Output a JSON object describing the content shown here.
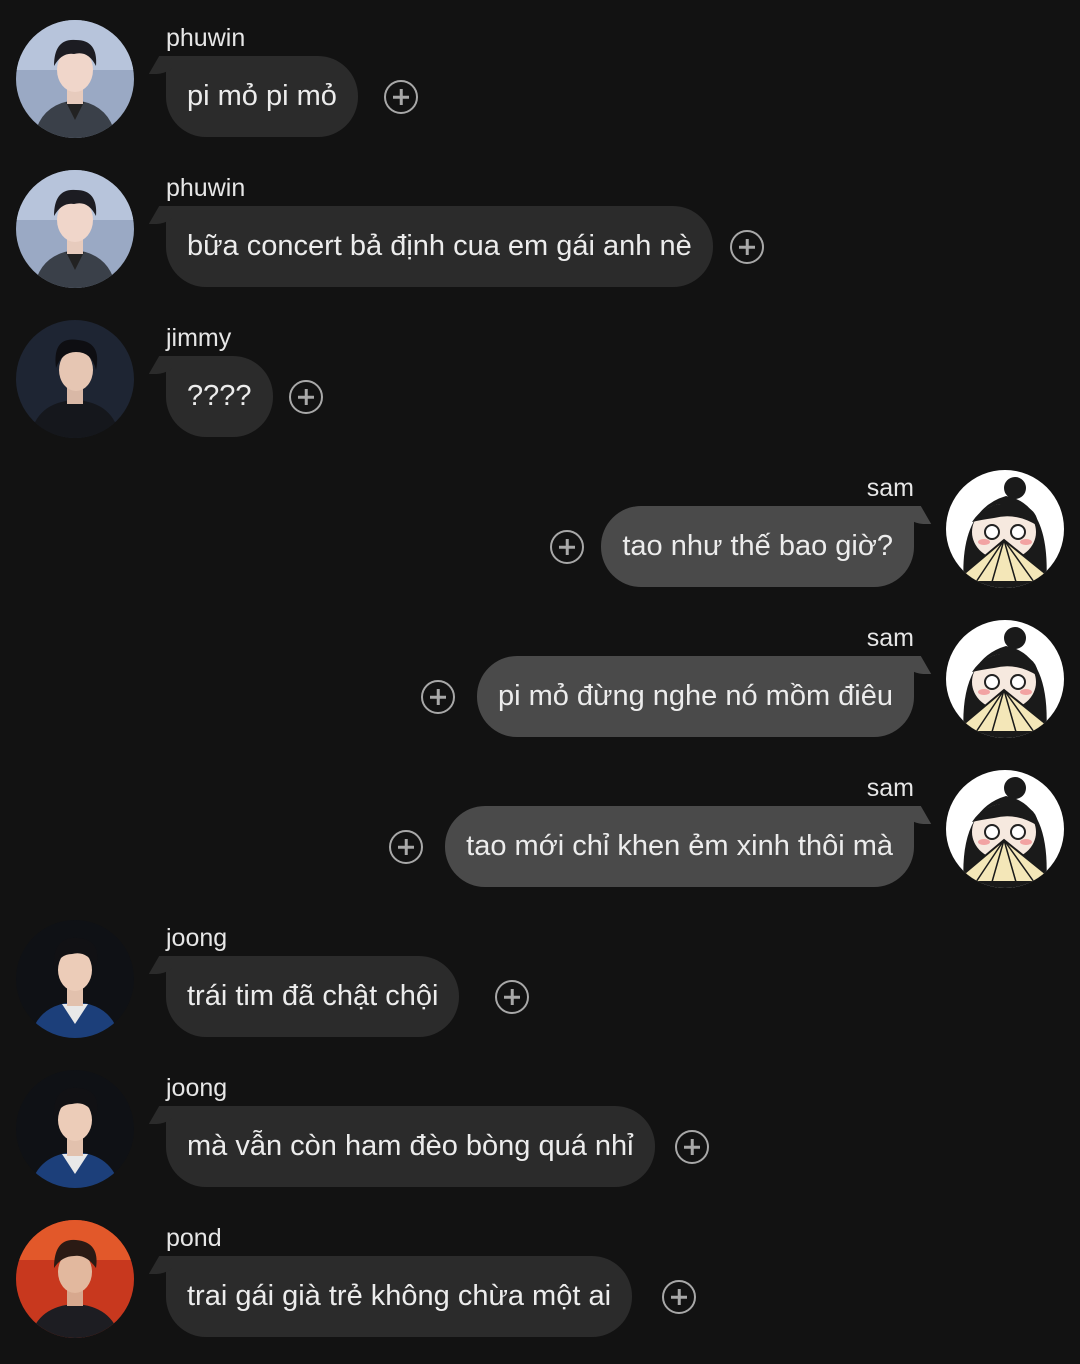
{
  "messages": [
    {
      "sender": "phuwin",
      "text": "pi mỏ pi mỏ",
      "outgoing": false,
      "avatar": "phuwin"
    },
    {
      "sender": "phuwin",
      "text": "bữa concert bả định cua em gái anh nè",
      "outgoing": false,
      "avatar": "phuwin"
    },
    {
      "sender": "jimmy",
      "text": "????",
      "outgoing": false,
      "avatar": "jimmy"
    },
    {
      "sender": "sam",
      "text": "tao như thế bao giờ?",
      "outgoing": true,
      "avatar": "sam"
    },
    {
      "sender": "sam",
      "text": "pi mỏ đừng nghe nó mồm điêu",
      "outgoing": true,
      "avatar": "sam"
    },
    {
      "sender": "sam",
      "text": "tao mới chỉ khen ẻm xinh thôi mà",
      "outgoing": true,
      "avatar": "sam"
    },
    {
      "sender": "joong",
      "text": "trái tim đã chật chội",
      "outgoing": false,
      "avatar": "joong"
    },
    {
      "sender": "joong",
      "text": "mà vẫn còn ham đèo bòng quá nhỉ",
      "outgoing": false,
      "avatar": "joong"
    },
    {
      "sender": "pond",
      "text": "trai gái già trẻ không chừa một ai",
      "outgoing": false,
      "avatar": "pond"
    }
  ],
  "icons": {
    "reaction": "add-reaction-icon"
  },
  "colors": {
    "background": "#121212",
    "incoming_bubble": "#2b2b2b",
    "outgoing_bubble": "#4a4a4a",
    "text": "#ececec",
    "icon": "#a8a8a8"
  }
}
